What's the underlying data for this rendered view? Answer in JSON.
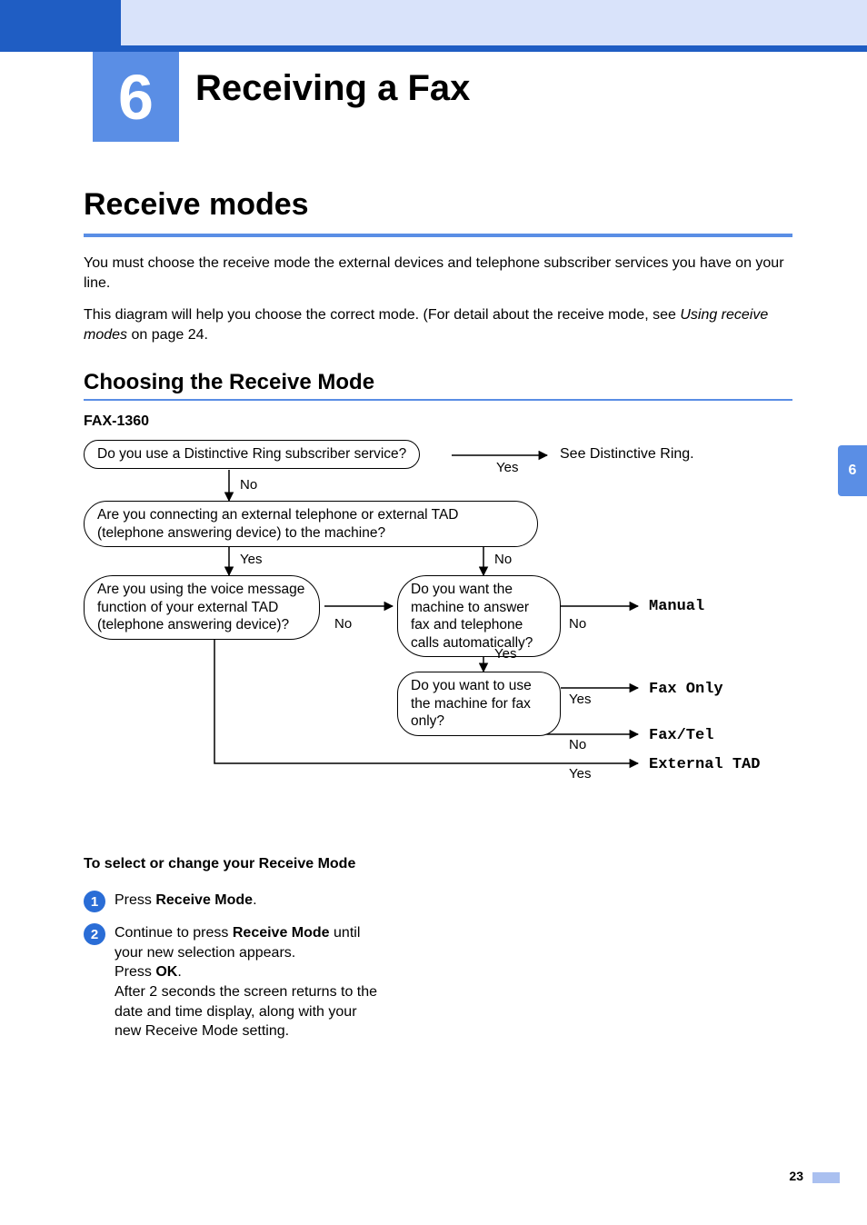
{
  "chapter": {
    "number": "6",
    "title": "Receiving a Fax"
  },
  "section": {
    "h1": "Receive modes",
    "para1": "You must choose the receive mode the external devices and telephone subscriber services you have on your line.",
    "para2a": "This diagram will help you choose the correct mode. (For detail about the receive mode, see ",
    "para2_ital": "Using receive modes",
    "para2b": " on page 24."
  },
  "h2": "Choosing the Receive Mode",
  "model": "FAX-1360",
  "flow": {
    "q1": "Do you use a Distinctive Ring subscriber service?",
    "q2": "Are you connecting an external telephone or external TAD (telephone answering device) to the machine?",
    "q3": "Are you using the voice message function of your external TAD (telephone answering device)?",
    "q4": "Do you want the machine to answer fax and telephone calls automatically?",
    "q5": "Do you want to use the machine for fax only?",
    "yes": "Yes",
    "no": "No",
    "r_distinctive": "See Distinctive Ring.",
    "r_manual": "Manual",
    "r_faxonly": "Fax Only",
    "r_faxtel": "Fax/Tel",
    "r_exttad": "External TAD"
  },
  "steps": {
    "heading": "To select or change your Receive Mode",
    "s1_a": "Press ",
    "s1_b": "Receive Mode",
    "s1_c": ".",
    "s2_a": "Continue to press ",
    "s2_b": "Receive Mode",
    "s2_c": " until your new selection appears.",
    "s2_d": "Press ",
    "s2_e": "OK",
    "s2_f": ".",
    "s2_g": "After 2 seconds the screen returns to the date and time display, along with your new Receive Mode setting."
  },
  "sideTab": "6",
  "pageNum": "23",
  "chart_data": {
    "type": "flowchart",
    "model": "FAX-1360",
    "nodes": [
      {
        "id": "q1",
        "text": "Do you use a Distinctive Ring subscriber service?",
        "type": "decision"
      },
      {
        "id": "q2",
        "text": "Are you connecting an external telephone or external TAD (telephone answering device) to the machine?",
        "type": "decision"
      },
      {
        "id": "q3",
        "text": "Are you using the voice message function of your external TAD (telephone answering device)?",
        "type": "decision"
      },
      {
        "id": "q4",
        "text": "Do you want the machine to answer fax and telephone calls automatically?",
        "type": "decision"
      },
      {
        "id": "q5",
        "text": "Do you want to use the machine for fax only?",
        "type": "decision"
      },
      {
        "id": "r_distinctive",
        "text": "See Distinctive Ring.",
        "type": "result"
      },
      {
        "id": "r_manual",
        "text": "Manual",
        "type": "result"
      },
      {
        "id": "r_faxonly",
        "text": "Fax Only",
        "type": "result"
      },
      {
        "id": "r_faxtel",
        "text": "Fax/Tel",
        "type": "result"
      },
      {
        "id": "r_exttad",
        "text": "External TAD",
        "type": "result"
      }
    ],
    "edges": [
      {
        "from": "q1",
        "to": "r_distinctive",
        "label": "Yes"
      },
      {
        "from": "q1",
        "to": "q2",
        "label": "No"
      },
      {
        "from": "q2",
        "to": "q3",
        "label": "Yes"
      },
      {
        "from": "q2",
        "to": "q4",
        "label": "No"
      },
      {
        "from": "q3",
        "to": "q4",
        "label": "No"
      },
      {
        "from": "q3",
        "to": "r_exttad",
        "label": "Yes"
      },
      {
        "from": "q4",
        "to": "r_manual",
        "label": "No"
      },
      {
        "from": "q4",
        "to": "q5",
        "label": "Yes"
      },
      {
        "from": "q5",
        "to": "r_faxonly",
        "label": "Yes"
      },
      {
        "from": "q5",
        "to": "r_faxtel",
        "label": "No"
      }
    ]
  }
}
